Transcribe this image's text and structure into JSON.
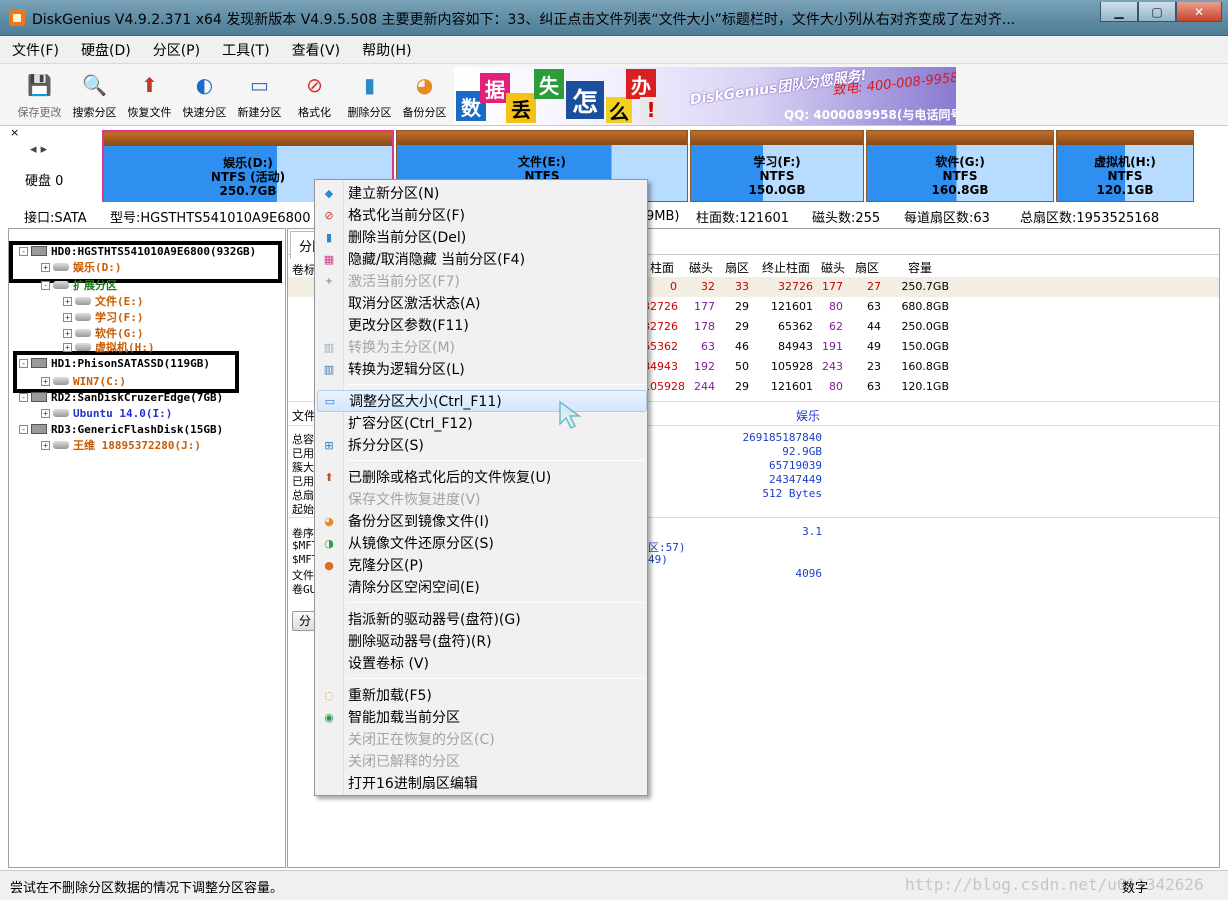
{
  "window": {
    "title": "DiskGenius V4.9.2.371 x64    发现新版本 V4.9.5.508 主要更新内容如下：33、纠正点击文件列表“文件大小”标题栏时，文件大小列从右对齐变成了左对齐..."
  },
  "menu": [
    "文件(F)",
    "硬盘(D)",
    "分区(P)",
    "工具(T)",
    "查看(V)",
    "帮助(H)"
  ],
  "toolbar": [
    {
      "label": "保存更改",
      "icon": "save-icon",
      "disabled": true
    },
    {
      "label": "搜索分区",
      "icon": "search-partition-icon"
    },
    {
      "label": "恢复文件",
      "icon": "recover-files-icon"
    },
    {
      "label": "快速分区",
      "icon": "quick-partition-icon"
    },
    {
      "label": "新建分区",
      "icon": "new-partition-icon"
    },
    {
      "label": "格式化",
      "icon": "format-icon"
    },
    {
      "label": "删除分区",
      "icon": "delete-partition-icon"
    },
    {
      "label": "备份分区",
      "icon": "backup-partition-icon"
    }
  ],
  "banner": {
    "chars": [
      "数",
      "据",
      "丢",
      "失",
      "怎",
      "么",
      "办",
      "!"
    ],
    "brand": "DiskGenius团队为您服务!",
    "tel": "致电: 400-008-9958",
    "qq": "QQ: 4000089958(与电话同号)"
  },
  "diskmap": {
    "close": "×",
    "nav": "◂ ▸",
    "disk_label": "硬盘 0",
    "partitions": [
      {
        "name": "娱乐(D:)",
        "fs": "NTFS (活动)",
        "size": "250.7GB",
        "selected": true
      },
      {
        "name": "文件(E:)",
        "fs": "NTFS",
        "size": ""
      },
      {
        "name": "学习(F:)",
        "fs": "NTFS",
        "size": "150.0GB"
      },
      {
        "name": "软件(G:)",
        "fs": "NTFS",
        "size": "160.8GB"
      },
      {
        "name": "虚拟机(H:)",
        "fs": "NTFS",
        "size": "120.1GB"
      }
    ]
  },
  "diskinfo": {
    "interface": "接口:SATA",
    "model": "型号:HGSTHTS541010A9E6800",
    "capacity_tail": "9MB)",
    "cylinders": "柱面数:121601",
    "heads": "磁头数:255",
    "sectors_per_track": "每道扇区数:63",
    "total_sectors": "总扇区数:1953525168"
  },
  "tree": [
    {
      "text": "HD0:HGSTHTS541010A9E6800(932GB)",
      "level": 0,
      "expander": "-",
      "type": "disk",
      "color": "#000000",
      "bold": true
    },
    {
      "text": "娱乐(D:)",
      "level": 1,
      "expander": "+",
      "type": "part",
      "color": "#c85a00",
      "bold": true
    },
    {
      "text": "扩展分区",
      "level": 1,
      "expander": "-",
      "type": "part",
      "color": "#1f7a1f",
      "bold": true
    },
    {
      "text": "文件(E:)",
      "level": 2,
      "expander": "+",
      "type": "part",
      "color": "#c85a00",
      "bold": true
    },
    {
      "text": "学习(F:)",
      "level": 2,
      "expander": "+",
      "type": "part",
      "color": "#c85a00",
      "bold": true
    },
    {
      "text": "软件(G:)",
      "level": 2,
      "expander": "+",
      "type": "part",
      "color": "#c85a00",
      "bold": true
    },
    {
      "text": "虚拟机(H:)",
      "level": 2,
      "expander": "+",
      "type": "part",
      "color": "#c85a00",
      "bold": true
    },
    {
      "text": "HD1:PhisonSATASSD(119GB)",
      "level": 0,
      "expander": "-",
      "type": "disk",
      "color": "#000000",
      "bold": true
    },
    {
      "text": "WIN7(C:)",
      "level": 1,
      "expander": "+",
      "type": "part",
      "color": "#c85a00",
      "bold": true
    },
    {
      "text": "RD2:SanDiskCruzerEdge(7GB)",
      "level": 0,
      "expander": "-",
      "type": "disk",
      "color": "#000000",
      "bold": true
    },
    {
      "text": "Ubuntu 14.0(I:)",
      "level": 1,
      "expander": "+",
      "type": "part",
      "color": "#2233cc",
      "bold": true
    },
    {
      "text": "RD3:GenericFlashDisk(15GB)",
      "level": 0,
      "expander": "-",
      "type": "disk",
      "color": "#000000",
      "bold": true
    },
    {
      "text": "王维 18895372280(J:)",
      "level": 1,
      "expander": "+",
      "type": "part",
      "color": "#c85a00",
      "bold": true
    }
  ],
  "right": {
    "tab_label": "分区",
    "vol_label_head": "卷标",
    "headers": [
      "柱面",
      "磁头",
      "扇区",
      "终止柱面",
      "磁头",
      "扇区",
      "容量"
    ],
    "rows": [
      [
        "0",
        "32",
        "33",
        "32726",
        "177",
        "27",
        "250.7GB"
      ],
      [
        "32726",
        "177",
        "29",
        "121601",
        "80",
        "63",
        "680.8GB"
      ],
      [
        "32726",
        "178",
        "29",
        "65362",
        "62",
        "44",
        "250.0GB"
      ],
      [
        "65362",
        "63",
        "46",
        "84943",
        "191",
        "49",
        "150.0GB"
      ],
      [
        "84943",
        "192",
        "50",
        "105928",
        "243",
        "23",
        "160.8GB"
      ],
      [
        "105928",
        "244",
        "29",
        "121601",
        "80",
        "63",
        "120.1GB"
      ]
    ],
    "info_head_left": "文件",
    "info_head_value": "娱乐",
    "info_left": [
      "总容",
      "已用",
      "簇大",
      "已用",
      "总扇",
      "起始"
    ],
    "info_values": [
      "269185187840",
      "92.9GB",
      "65719039",
      "24347449",
      "512 Bytes"
    ],
    "info2_left": [
      "卷序",
      "$MFT",
      "$MFT",
      "文件",
      "卷GU"
    ],
    "info2_values": [
      "3.1",
      "区:57)",
      "49)",
      "4096"
    ],
    "button_stub": "分"
  },
  "context_menu": [
    {
      "label": "建立新分区(N)",
      "icon": "new-partition-icon",
      "disabled": false
    },
    {
      "label": "格式化当前分区(F)",
      "icon": "format-icon",
      "disabled": false
    },
    {
      "label": "删除当前分区(Del)",
      "icon": "delete-icon",
      "disabled": false
    },
    {
      "label": "隐藏/取消隐藏 当前分区(F4)",
      "icon": "hide-icon",
      "disabled": false
    },
    {
      "label": "激活当前分区(F7)",
      "icon": "activate-icon",
      "disabled": true
    },
    {
      "label": "取消分区激活状态(A)",
      "icon": "",
      "disabled": false
    },
    {
      "label": "更改分区参数(F11)",
      "icon": "",
      "disabled": false
    },
    {
      "label": "转换为主分区(M)",
      "icon": "convert-primary-icon",
      "disabled": true
    },
    {
      "label": "转换为逻辑分区(L)",
      "icon": "convert-logical-icon",
      "disabled": false
    },
    {
      "sep": true
    },
    {
      "label": "调整分区大小(Ctrl_F11)",
      "icon": "resize-icon",
      "disabled": false,
      "hover": true
    },
    {
      "label": "扩容分区(Ctrl_F12)",
      "icon": "",
      "disabled": false
    },
    {
      "label": "拆分分区(S)",
      "icon": "split-icon",
      "disabled": false
    },
    {
      "sep": true
    },
    {
      "label": "已删除或格式化后的文件恢复(U)",
      "icon": "recover-icon",
      "disabled": false
    },
    {
      "label": "保存文件恢复进度(V)",
      "icon": "",
      "disabled": true
    },
    {
      "label": "备份分区到镜像文件(I)",
      "icon": "backup-icon",
      "disabled": false
    },
    {
      "label": "从镜像文件还原分区(S)",
      "icon": "restore-icon",
      "disabled": false
    },
    {
      "label": "克隆分区(P)",
      "icon": "clone-icon",
      "disabled": false
    },
    {
      "label": "清除分区空闲空间(E)",
      "icon": "",
      "disabled": false
    },
    {
      "sep": true
    },
    {
      "label": "指派新的驱动器号(盘符)(G)",
      "icon": "",
      "disabled": false
    },
    {
      "label": "删除驱动器号(盘符)(R)",
      "icon": "",
      "disabled": false
    },
    {
      "label": "设置卷标 (V)",
      "icon": "",
      "disabled": false
    },
    {
      "sep": true
    },
    {
      "label": "重新加载(F5)",
      "icon": "reload-icon",
      "disabled": false
    },
    {
      "label": "智能加载当前分区",
      "icon": "smart-load-icon",
      "disabled": false
    },
    {
      "label": "关闭正在恢复的分区(C)",
      "icon": "",
      "disabled": true
    },
    {
      "label": "关闭已解释的分区",
      "icon": "",
      "disabled": true
    },
    {
      "label": "打开16进制扇区编辑",
      "icon": "",
      "disabled": false
    }
  ],
  "status": {
    "text": "尝试在不删除分区数据的情况下调整分区容量。",
    "right": "数字",
    "watermark": "http://blog.csdn.net/u011342626"
  }
}
